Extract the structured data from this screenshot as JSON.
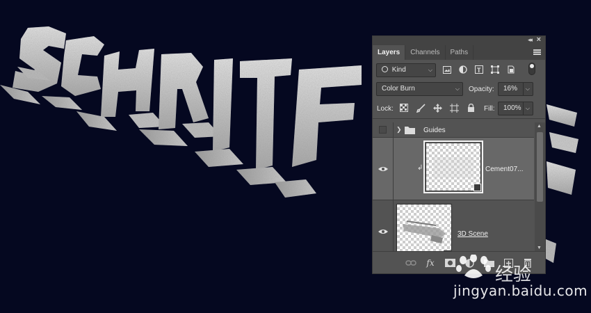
{
  "panel": {
    "tabs": [
      {
        "label": "Layers",
        "active": true
      },
      {
        "label": "Channels",
        "active": false
      },
      {
        "label": "Paths",
        "active": false
      }
    ],
    "filter": {
      "kind_label": "Kind"
    },
    "blend": {
      "mode": "Color Burn",
      "opacity_label": "Opacity:",
      "opacity_value": "16%"
    },
    "lock": {
      "lock_label": "Lock:",
      "fill_label": "Fill:",
      "fill_value": "100%"
    },
    "layers": [
      {
        "name": "Guides",
        "type": "group",
        "visible": false
      },
      {
        "name": "Cement07...",
        "type": "smart-object",
        "visible": true,
        "selected": true,
        "clipped": true
      },
      {
        "name": "3D Scene",
        "type": "3d",
        "visible": true
      }
    ]
  },
  "watermark": {
    "chinese": "经验",
    "url": "jingyan.baidu.com"
  },
  "colors": {
    "background": "#050820",
    "panel": "#535353",
    "panel_dark": "#434343",
    "selected_layer": "#686868"
  },
  "artwork": {
    "letters": [
      "S",
      "C",
      "H",
      "R",
      "I",
      "F",
      "T",
      "E"
    ]
  }
}
